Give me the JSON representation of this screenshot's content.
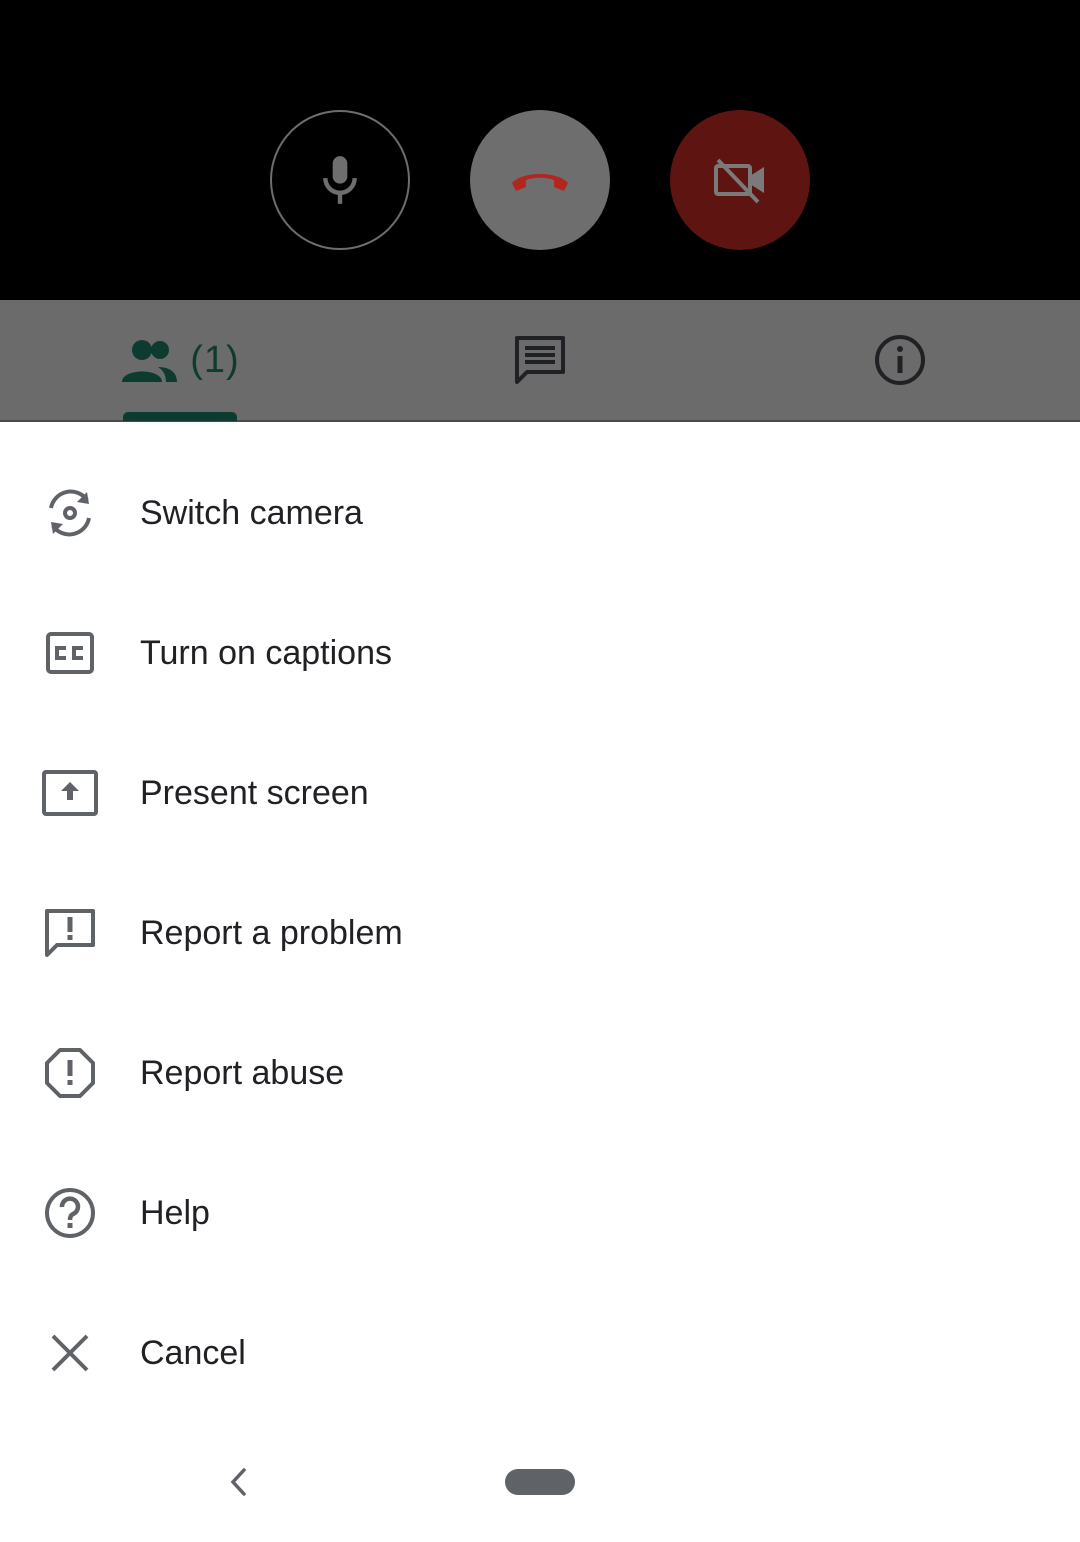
{
  "call_controls": {
    "microphone": "mic-icon",
    "end_call": "end-call-icon",
    "camera": "camera-off-icon",
    "end_call_color": "#b3261e",
    "camera_button_color": "#5e1410"
  },
  "tabs": [
    {
      "icon": "people-icon",
      "count": "(1)",
      "selected": true
    },
    {
      "icon": "chat-icon"
    },
    {
      "icon": "info-icon"
    }
  ],
  "accent_color": "#0e3b30",
  "menu": {
    "items": [
      {
        "label": "Switch camera",
        "icon": "switch-camera-icon"
      },
      {
        "label": "Turn on captions",
        "icon": "captions-icon"
      },
      {
        "label": "Present screen",
        "icon": "present-screen-icon"
      },
      {
        "label": "Report a problem",
        "icon": "report-problem-icon"
      },
      {
        "label": "Report abuse",
        "icon": "report-abuse-icon"
      },
      {
        "label": "Help",
        "icon": "help-icon"
      },
      {
        "label": "Cancel",
        "icon": "close-icon"
      }
    ]
  },
  "navigation": {
    "back": "back-icon",
    "home": "home-pill"
  }
}
